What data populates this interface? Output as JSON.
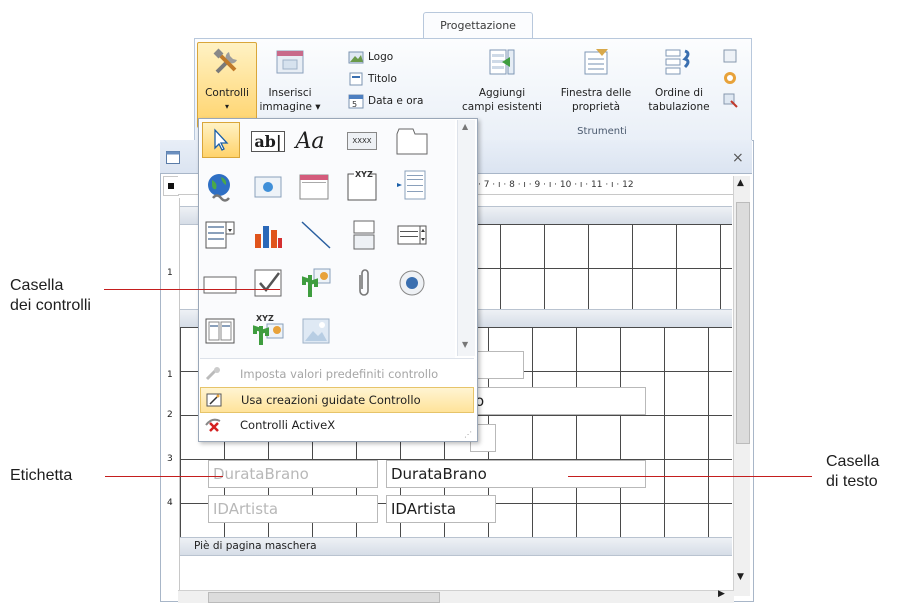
{
  "ribbon": {
    "tab_label": "Progettazione",
    "controls_button": "Controlli",
    "insert_image_line1": "Inserisci",
    "insert_image_line2": "immagine ▾",
    "logo": "Logo",
    "title": "Titolo",
    "date_time": "Data e ora",
    "add_fields_line1": "Aggiungi",
    "add_fields_line2": "campi esistenti",
    "property_sheet_line1": "Finestra delle",
    "property_sheet_line2": "proprietà",
    "tab_order_line1": "Ordine di",
    "tab_order_line2": "tabulazione",
    "group_tools": "Strumenti"
  },
  "palette": {
    "menu_set_defaults": "Imposta valori predefiniti controllo",
    "menu_use_wizards": "Usa creazioni guidate Controllo",
    "menu_activex": "Controlli ActiveX",
    "textbox_glyph": "ab|",
    "label_glyph": "Aa",
    "xyz_glyph": "XYZ",
    "xxxx_glyph": "XXXX"
  },
  "form": {
    "ruler_marks": "· 7 · ı · 8 · ı · 9 · ı · 10 · ı · 11 · ı · 12",
    "footer_section": "Piè di pagina maschera",
    "label_duration": "DurataBrano",
    "textbox_duration": "DurataBrano",
    "label_artist": "IDArtista",
    "textbox_artist": "IDArtista",
    "partial_text": "o",
    "close": "×"
  },
  "callouts": {
    "toolbox_line1": "Casella",
    "toolbox_line2": "dei controlli",
    "label": "Etichetta",
    "textbox_line1": "Casella",
    "textbox_line2": "di testo"
  },
  "colors": {
    "accent_highlight": "#ffd36b",
    "callout_line": "#c41e1e"
  }
}
